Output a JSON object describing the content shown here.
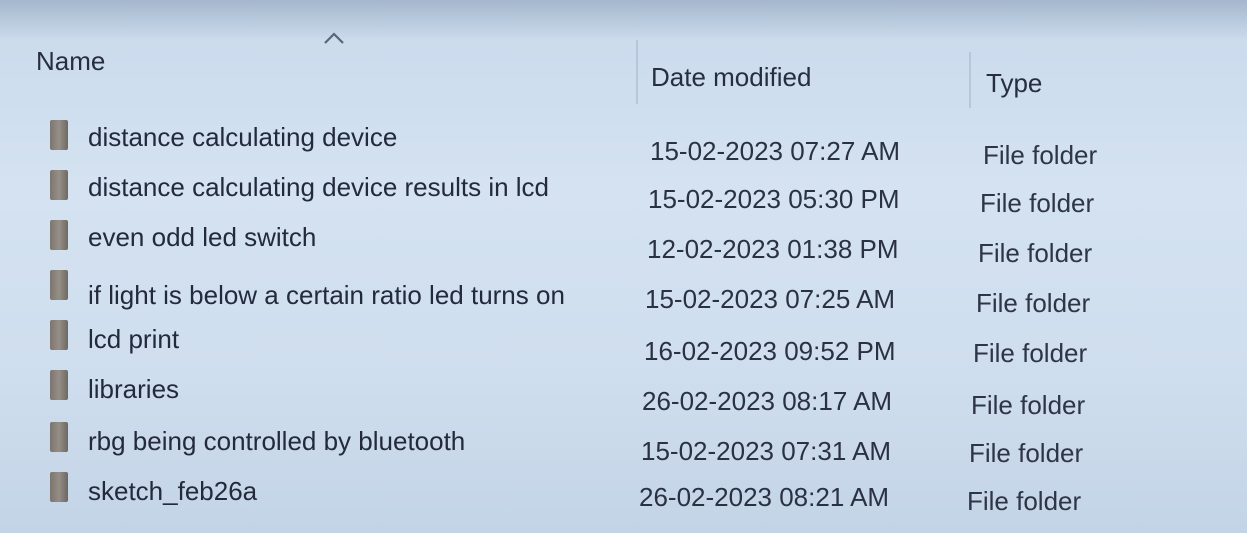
{
  "columns": {
    "name": "Name",
    "date": "Date modified",
    "type": "Type"
  },
  "sort": {
    "column": "name",
    "direction": "ascending",
    "icon": "chevron-up-icon"
  },
  "rows": [
    {
      "name": "distance calculating device",
      "date": "15-02-2023 07:27 AM",
      "type": "File folder",
      "icon": "folder-icon"
    },
    {
      "name": "distance calculating device results in lcd",
      "date": "15-02-2023 05:30 PM",
      "type": "File folder",
      "icon": "folder-icon"
    },
    {
      "name": "even odd led switch",
      "date": "12-02-2023 01:38 PM",
      "type": "File folder",
      "icon": "folder-icon"
    },
    {
      "name": "if light is below a certain ratio led turns on",
      "date": "15-02-2023 07:25 AM",
      "type": "File folder",
      "icon": "folder-icon"
    },
    {
      "name": "lcd print",
      "date": "16-02-2023 09:52 PM",
      "type": "File folder",
      "icon": "folder-icon"
    },
    {
      "name": "libraries",
      "date": "26-02-2023 08:17 AM",
      "type": "File folder",
      "icon": "folder-icon"
    },
    {
      "name": "rbg being controlled by bluetooth",
      "date": "15-02-2023 07:31 AM",
      "type": "File folder",
      "icon": "folder-icon"
    },
    {
      "name": "sketch_feb26a",
      "date": "26-02-2023 08:21 AM",
      "type": "File folder",
      "icon": "folder-icon"
    }
  ]
}
